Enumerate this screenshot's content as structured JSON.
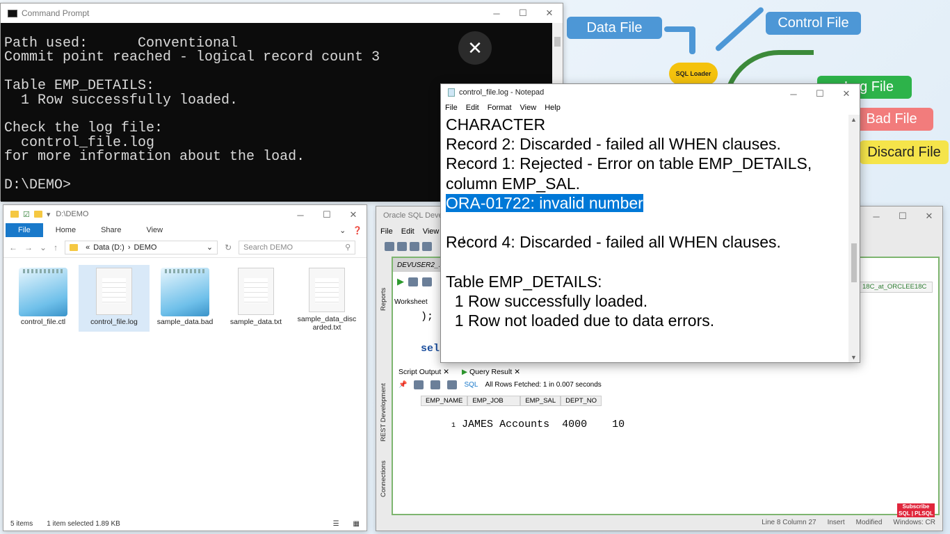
{
  "diagram": {
    "data_file": "Data File",
    "control_file": "Control File",
    "log_file": "Log File",
    "bad_file": "Bad File",
    "discard_file": "Discard File",
    "loader_label": "SQL Loader",
    "colors": {
      "blue": "#4d97d6",
      "green": "#2db34a",
      "red": "#f27c7c",
      "yellow": "#f5e44a"
    }
  },
  "cmd": {
    "title": "Command Prompt",
    "lines": [
      "Path used:      Conventional",
      "Commit point reached - logical record count 3",
      "",
      "Table EMP_DETAILS:",
      "  1 Row successfully loaded.",
      "",
      "Check the log file:",
      "  control_file.log",
      "for more information about the load.",
      "",
      "D:\\DEMO>"
    ]
  },
  "overlay_close": "✕",
  "explorer": {
    "title": "D:\\DEMO",
    "tabs": {
      "file": "File",
      "home": "Home",
      "share": "Share",
      "view": "View"
    },
    "address": {
      "prefix": "«",
      "drive": "Data (D:)",
      "sep": "›",
      "folder": "DEMO"
    },
    "search_placeholder": "Search DEMO",
    "files": [
      {
        "name": "control_file.ctl",
        "icon": "notepad-icon"
      },
      {
        "name": "control_file.log",
        "icon": "document-icon"
      },
      {
        "name": "sample_data.bad",
        "icon": "notepad-icon"
      },
      {
        "name": "sample_data.txt",
        "icon": "document-icon"
      },
      {
        "name": "sample_data_discarded.txt",
        "icon": "document-icon"
      }
    ],
    "status": {
      "count": "5 items",
      "selected": "1 item selected  1.89 KB"
    }
  },
  "sqldev": {
    "title": "Oracle SQL Developer",
    "menu": {
      "file": "File",
      "edit": "Edit",
      "view": "View"
    },
    "editor_tab": "DEVUSER2_...",
    "worksheet_label": "Worksheet",
    "connection": "18C_at_ORCLEE18C",
    "code_line1": ");",
    "code_line2": "sel",
    "sidebar": {
      "reports": "Reports",
      "rest": "REST Development",
      "connections": "Connections"
    },
    "results_tabs": {
      "script_output": "Script Output",
      "query_result": "Query Result"
    },
    "fetch_status": "All Rows Fetched: 1 in 0.007 seconds",
    "sql_label": "SQL",
    "columns": [
      "EMP_NAME",
      "EMP_JOB",
      "EMP_SAL",
      "DEPT_NO"
    ],
    "rows": [
      {
        "num": "1",
        "emp_name": "JAMES",
        "emp_job": "Accounts",
        "emp_sal": "4000",
        "dept_no": "10"
      }
    ],
    "status": {
      "position": "Line 8 Column 27",
      "mode": "Insert",
      "modified": "Modified",
      "platform": "Windows: CR"
    }
  },
  "notepad": {
    "title": "control_file.log - Notepad",
    "menu": {
      "file": "File",
      "edit": "Edit",
      "format": "Format",
      "view": "View",
      "help": "Help"
    },
    "lines": {
      "l1": "CHARACTER",
      "l2": "",
      "l3": "Record 2: Discarded - failed all WHEN clauses.",
      "l4": "Record 1: Rejected - Error on table EMP_DETAILS,",
      "l5": "column EMP_SAL.",
      "l6_highlight": "ORA-01722: invalid number",
      "l7": "",
      "l8": "Record 4: Discarded - failed all WHEN clauses.",
      "l9": "",
      "l10": "Table EMP_DETAILS:",
      "l11": "  1 Row successfully loaded.",
      "l12": "  1 Row not loaded due to data errors."
    }
  },
  "subscribe": {
    "line1": "Subscribe",
    "line2": "SQL | PLSQL"
  }
}
